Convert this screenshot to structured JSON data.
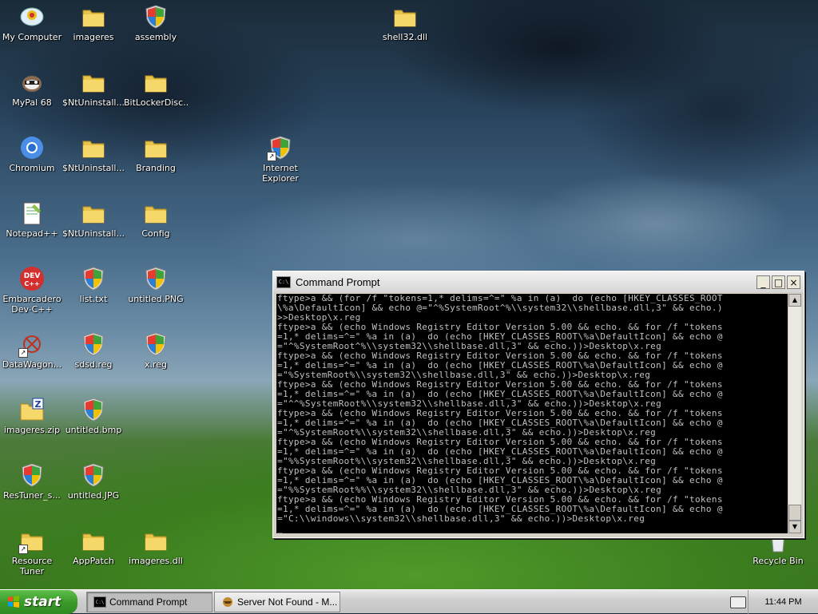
{
  "desktop": {
    "icons": [
      {
        "label": "My Computer",
        "icon": "my-computer-icon"
      },
      {
        "label": "imageres",
        "icon": "folder-icon"
      },
      {
        "label": "assembly",
        "icon": "shield-icon"
      },
      {
        "label": "shell32.dll",
        "icon": "folder-icon"
      },
      {
        "label": "MyPal 68",
        "icon": "mypal-icon"
      },
      {
        "label": "$NtUninstall...",
        "icon": "folder-icon"
      },
      {
        "label": "BitLockerDisc...",
        "icon": "folder-icon"
      },
      {
        "label": "Chromium",
        "icon": "chromium-icon"
      },
      {
        "label": "$NtUninstall...",
        "icon": "folder-icon"
      },
      {
        "label": "Branding",
        "icon": "folder-icon"
      },
      {
        "label": "Internet Explorer",
        "icon": "shield-icon"
      },
      {
        "label": "Notepad++",
        "icon": "notepad-icon"
      },
      {
        "label": "$NtUninstall...",
        "icon": "folder-icon"
      },
      {
        "label": "Config",
        "icon": "folder-icon"
      },
      {
        "label": "Embarcadero Dev-C++",
        "icon": "devcpp-icon"
      },
      {
        "label": "list.txt",
        "icon": "shield-icon"
      },
      {
        "label": "untitled.PNG",
        "icon": "shield-icon"
      },
      {
        "label": "DataWagon...",
        "icon": "datawagon-icon"
      },
      {
        "label": "sdsd.reg",
        "icon": "shield-icon"
      },
      {
        "label": "x.reg",
        "icon": "shield-icon"
      },
      {
        "label": "imageres.zip",
        "icon": "zip-icon"
      },
      {
        "label": "untitled.bmp",
        "icon": "shield-icon"
      },
      {
        "label": "ResTuner_s...",
        "icon": "shield-icon"
      },
      {
        "label": "untitled.JPG",
        "icon": "shield-icon"
      },
      {
        "label": "Resource Tuner",
        "icon": "folder-icon"
      },
      {
        "label": "AppPatch",
        "icon": "folder-icon"
      },
      {
        "label": "imageres.dll",
        "icon": "folder-icon"
      },
      {
        "label": "Recycle Bin",
        "icon": "recycle-bin-icon"
      }
    ]
  },
  "window": {
    "title": "Command Prompt",
    "minimize": "_",
    "maximize": "□",
    "close": "×",
    "console_text": "ftype>a && (for /f \"tokens=1,* delims=^=\" %a in (a)  do (echo [HKEY_CLASSES_ROOT\n\\%a\\DefaultIcon] && echo @=\"^%SystemRoot^%\\\\system32\\\\shellbase.dll,3\" && echo.)\n>>Desktop\\x.reg\nftype>a && (echo Windows Registry Editor Version 5.00 && echo. && for /f \"tokens\n=1,* delims=^=\" %a in (a)  do (echo [HKEY_CLASSES_ROOT\\%a\\DefaultIcon] && echo @\n=\"^%SystemRoot^%\\\\system32\\\\shellbase.dll,3\" && echo.))>Desktop\\x.reg\nftype>a && (echo Windows Registry Editor Version 5.00 && echo. && for /f \"tokens\n=1,* delims=^=\" %a in (a)  do (echo [HKEY_CLASSES_ROOT\\%a\\DefaultIcon] && echo @\n=\"%SystemRoot%\\\\system32\\\\shellbase.dll,3\" && echo.))>Desktop\\x.reg\nftype>a && (echo Windows Registry Editor Version 5.00 && echo. && for /f \"tokens\n=1,* delims=^=\" %a in (a)  do (echo [HKEY_CLASSES_ROOT\\%a\\DefaultIcon] && echo @\n=\"^^%SystemRoot%\\\\system32\\\\shellbase.dll,3\" && echo.))>Desktop\\x.reg\nftype>a && (echo Windows Registry Editor Version 5.00 && echo. && for /f \"tokens\n=1,* delims=^=\" %a in (a)  do (echo [HKEY_CLASSES_ROOT\\%a\\DefaultIcon] && echo @\n=\"^%SystemRoot%\\\\system32\\\\shellbase.dll,3\" && echo.))>Desktop\\x.reg\nftype>a && (echo Windows Registry Editor Version 5.00 && echo. && for /f \"tokens\n=1,* delims=^=\" %a in (a)  do (echo [HKEY_CLASSES_ROOT\\%a\\DefaultIcon] && echo @\n=\"%%SystemRoot%\\\\system32\\\\shellbase.dll,3\" && echo.))>Desktop\\x.reg\nftype>a && (echo Windows Registry Editor Version 5.00 && echo. && for /f \"tokens\n=1,* delims=^=\" %a in (a)  do (echo [HKEY_CLASSES_ROOT\\%a\\DefaultIcon] && echo @\n=\"%%SystemRoot%%\\\\system32\\\\shellbase.dll,3\" && echo.))>Desktop\\x.reg\nftype>a && (echo Windows Registry Editor Version 5.00 && echo. && for /f \"tokens\n=1,* delims=^=\" %a in (a)  do (echo [HKEY_CLASSES_ROOT\\%a\\DefaultIcon] && echo @\n=\"C:\\\\windows\\\\system32\\\\shellbase.dll,3\" && echo.))>Desktop\\x.reg\n_"
  },
  "taskbar": {
    "start_label": "start",
    "tasks": [
      {
        "label": "Command Prompt",
        "icon": "cmd-icon",
        "active": true
      },
      {
        "label": "Server Not Found - M...",
        "icon": "browser-icon",
        "active": false
      }
    ],
    "clock": "11:44 PM"
  },
  "colors": {
    "console_bg": "#000000",
    "console_fg": "#c0c0c0",
    "start_green": "#3b9a2a",
    "taskbar_gray": "#d0d0d0"
  }
}
